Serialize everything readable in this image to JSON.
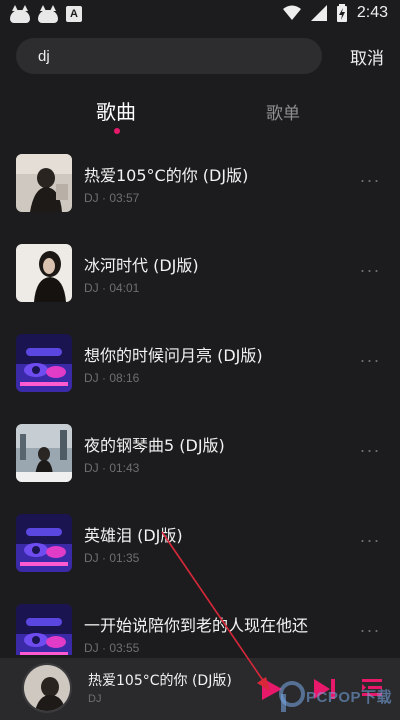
{
  "status_bar": {
    "time": "2:43",
    "notification_icons": [
      "cat-app-icon",
      "cat-app-icon",
      "a-app-icon"
    ],
    "a_icon_letter": "A",
    "system_icons": [
      "wifi-icon",
      "signal-icon",
      "battery-charging-icon"
    ]
  },
  "search": {
    "value": "dj",
    "cancel_label": "取消"
  },
  "tabs": [
    {
      "label": "歌曲",
      "active": true
    },
    {
      "label": "歌单",
      "active": false
    }
  ],
  "songs": [
    {
      "title": "热爱105°C的你 (DJ版)",
      "meta": "DJ · 03:57",
      "cover": "girl-photo"
    },
    {
      "title": "冰河时代 (DJ版)",
      "meta": "DJ · 04:01",
      "cover": "girl-photo"
    },
    {
      "title": "想你的时候问月亮 (DJ版)",
      "meta": "DJ · 08:16",
      "cover": "dj-deck"
    },
    {
      "title": "夜的钢琴曲5 (DJ版)",
      "meta": "DJ · 01:43",
      "cover": "city-photo"
    },
    {
      "title": "英雄泪 (DJ版)",
      "meta": "DJ · 01:35",
      "cover": "dj-deck"
    },
    {
      "title": "一开始说陪你到老的人现在他还",
      "meta": "DJ · 03:55",
      "cover": "dj-deck"
    }
  ],
  "now_playing": {
    "title": "热爱105°C的你 (DJ版)",
    "artist": "DJ"
  },
  "watermark": "PCPOP下载",
  "colors": {
    "background": "#1c1c1e",
    "accent": "#e8196a",
    "annotation": "#d8283a"
  }
}
